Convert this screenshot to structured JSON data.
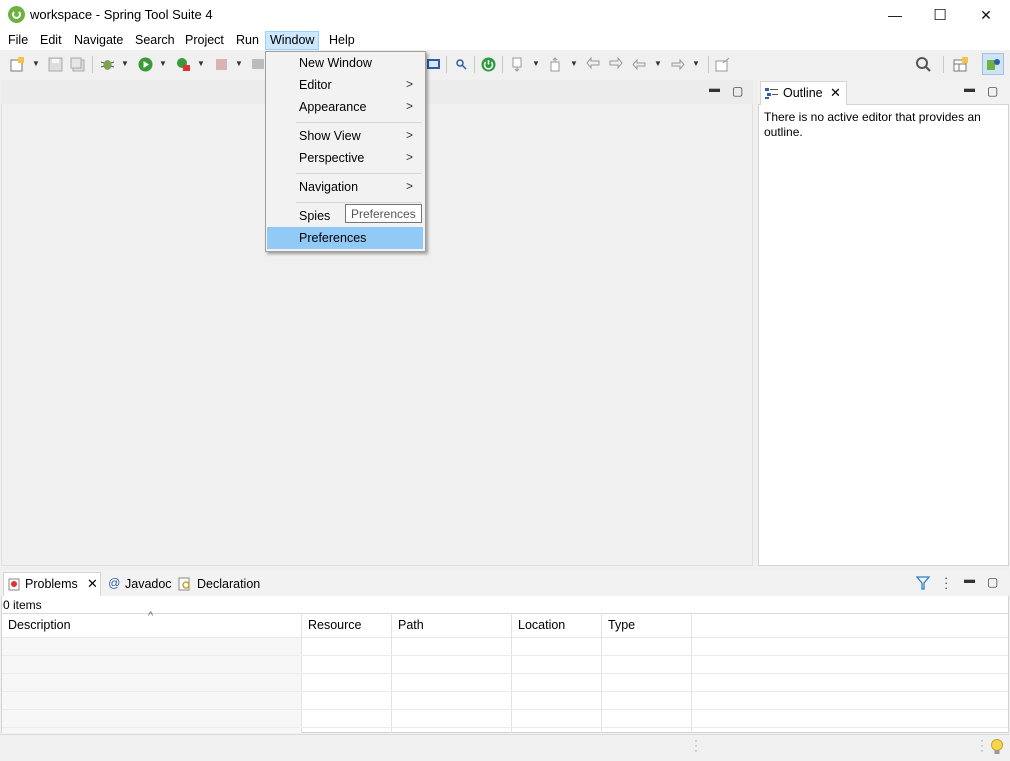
{
  "window": {
    "title": "workspace - Spring Tool Suite 4",
    "minimize": "—",
    "maximize": "☐",
    "close": "✕"
  },
  "menubar": {
    "file": "File",
    "edit": "Edit",
    "navigate": "Navigate",
    "search": "Search",
    "project": "Project",
    "run": "Run",
    "window": "Window",
    "help": "Help"
  },
  "window_menu": {
    "new_window": "New Window",
    "editor": "Editor",
    "appearance": "Appearance",
    "show_view": "Show View",
    "perspective": "Perspective",
    "navigation": "Navigation",
    "spies": "Spies",
    "preferences": "Preferences",
    "submenu_arrow": ">"
  },
  "tooltip": "Preferences",
  "outline": {
    "tab_label": "Outline",
    "message": "There is no active editor that provides an outline."
  },
  "problems": {
    "tabs": [
      "Problems",
      "Javadoc",
      "Declaration"
    ],
    "count": "0 items",
    "columns": [
      "Description",
      "Resource",
      "Path",
      "Location",
      "Type"
    ],
    "sort_indicator": "^"
  },
  "icons": {
    "app": "spring-leaf-icon",
    "search": "search-icon",
    "lightbulb": "lightbulb-icon"
  },
  "colors": {
    "menu_highlight": "#91c9f7",
    "menubar_active": "#cce8ff",
    "spring_green": "#6db33f"
  }
}
